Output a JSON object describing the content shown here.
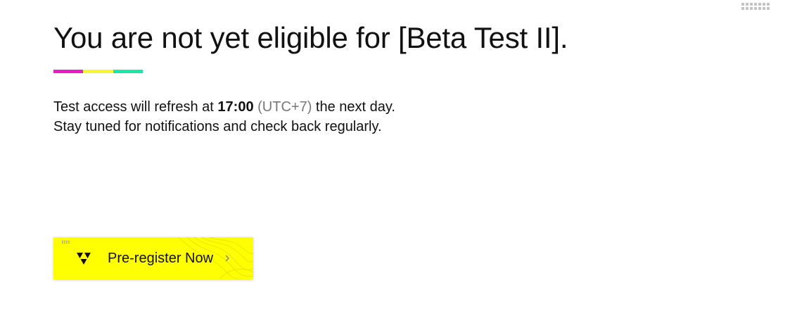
{
  "header": {
    "title": "You are not yet eligible for [Beta Test II].",
    "menu_icon": "grid-dots-icon"
  },
  "accent_colors": [
    "#e91ec4",
    "#f7f730",
    "#17e8a8"
  ],
  "message": {
    "line1_prefix": "Test access will refresh at ",
    "line1_time": "17:00",
    "line1_timezone": "(UTC+7)",
    "line1_suffix": " the next day.",
    "line2": "Stay tuned for notifications and check back regularly."
  },
  "cta": {
    "label": "Pre-register Now",
    "background": "#ffff00",
    "logo_icon": "triangle-logo-icon",
    "chevron_icon": "chevron-right-icon"
  }
}
